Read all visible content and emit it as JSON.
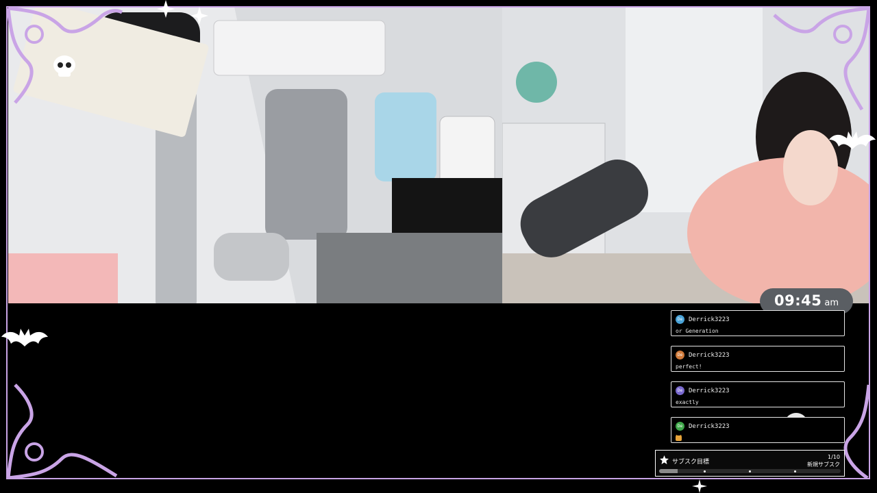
{
  "colors": {
    "frame": "#c9a4e6",
    "frame_dark": "#7b5a9c",
    "background": "#000000",
    "chat_border": "#e6e6e6",
    "clock_bg": "#5a5e63"
  },
  "clock": {
    "time": "09:45",
    "ampm": "am"
  },
  "chat": {
    "messages": [
      {
        "avatar_text": "De",
        "avatar_color": "#4aa3d8",
        "user": "Derrick3223",
        "text": "or Generation"
      },
      {
        "avatar_text": "De",
        "avatar_color": "#d07a3a",
        "user": "Derrick3223",
        "text": "perfect!"
      },
      {
        "avatar_text": "De",
        "avatar_color": "#7a6ad0",
        "user": "Derrick3223",
        "text": "exactly"
      },
      {
        "avatar_text": "De",
        "avatar_color": "#3fa84a",
        "user": "Derrick3223",
        "text": ""
      }
    ]
  },
  "sub_goal": {
    "title": "サブスク目標",
    "count": "1/10",
    "subtitle": "新規サブスク",
    "progress": 0.1
  },
  "icons": {
    "star": "star-icon",
    "skull": "skull-icon",
    "bat": "bat-icon",
    "emoji": "cat-emoji-icon"
  }
}
